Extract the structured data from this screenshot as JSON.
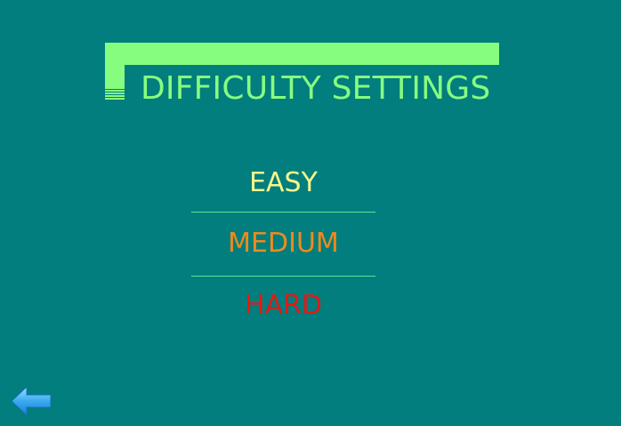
{
  "header": {
    "title": "DIFFICULTY SETTINGS"
  },
  "menu": {
    "items": [
      {
        "label": "EASY",
        "color": "#f6f68c"
      },
      {
        "label": "MEDIUM",
        "color": "#ee8a1e"
      },
      {
        "label": "HARD",
        "color": "#e11a17"
      }
    ]
  },
  "navigation": {
    "back_icon": "arrow-left-icon"
  },
  "colors": {
    "background": "#017e7d",
    "accent": "#87fd80",
    "divider": "#5fe39f",
    "back_arrow": "#3aaaf0"
  }
}
